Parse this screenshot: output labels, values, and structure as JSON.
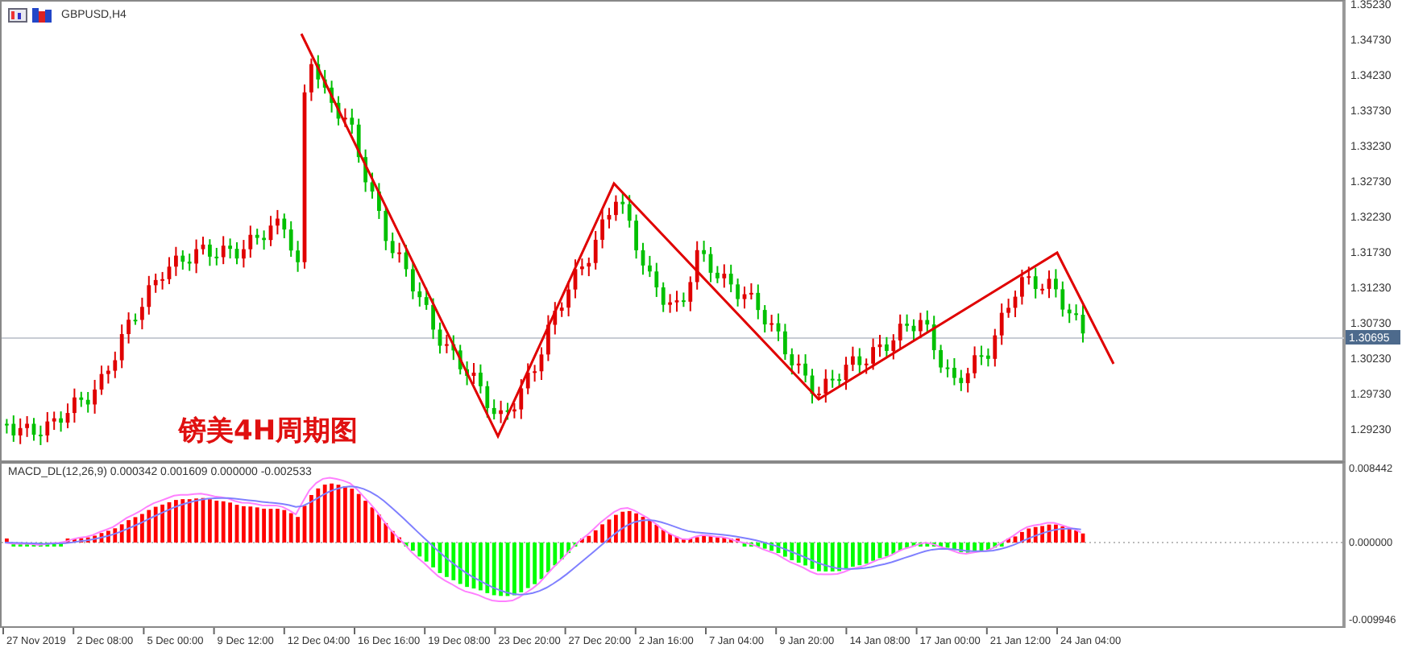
{
  "chart_window": {
    "title": "GBPUSD,H4",
    "overlay_caption": "镑美4H周期图",
    "price_axis": {
      "labels": [
        "1.35230",
        "1.34730",
        "1.34230",
        "1.33730",
        "1.33230",
        "1.32730",
        "1.32230",
        "1.31730",
        "1.31230",
        "1.30730",
        "1.30230",
        "1.29730",
        "1.29230"
      ],
      "current_price": "1.30695"
    }
  },
  "indicator": {
    "label": "MACD_DL(12,26,9) 0.000342 0.001609 0.000000 -0.002533",
    "axis_labels": [
      "0.008442",
      "0.000000",
      "-0.009946"
    ]
  },
  "time_axis": {
    "labels": [
      "27 Nov 2019",
      "2 Dec 08:00",
      "5 Dec 00:00",
      "9 Dec 12:00",
      "12 Dec 04:00",
      "16 Dec 16:00",
      "19 Dec 08:00",
      "23 Dec 20:00",
      "27 Dec 20:00",
      "2 Jan 16:00",
      "7 Jan 04:00",
      "9 Jan 20:00",
      "14 Jan 08:00",
      "17 Jan 00:00",
      "21 Jan 12:00",
      "24 Jan 04:00"
    ]
  }
}
